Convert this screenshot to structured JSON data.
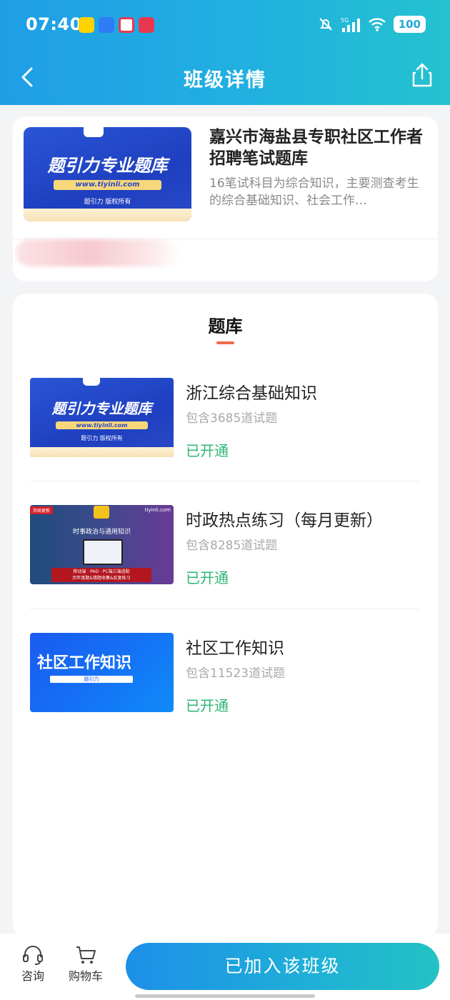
{
  "status_bar": {
    "time": "07:40",
    "battery": "100",
    "signal_label": "5G"
  },
  "nav": {
    "title": "班级详情"
  },
  "class_info": {
    "cover": {
      "title": "题引力专业题库",
      "url": "www.tiyinli.com",
      "copyright": "题引力 版权所有",
      "badge": "题引力"
    },
    "name": "嘉兴市海盐县专职社区工作者招聘笔试题库",
    "description": "16笔试科目为综合知识，主要测查考生的综合基础知识、社会工作…"
  },
  "bank": {
    "heading": "题库",
    "items": [
      {
        "title": "浙江综合基础知识",
        "count": "包含3685道试题",
        "status": "已开通",
        "cover_title": "题引力专业题库",
        "cover_url": "www.tiyinli.com",
        "cover_copyright": "题引力 版权所有",
        "cover_badge": "题引力"
      },
      {
        "title": "时政热点练习（每月更新）",
        "count": "包含8285道试题",
        "status": "已开通",
        "cover_tag": "持续更新",
        "cover_site": "tiyinli.com",
        "cover_heading": "时事政治与通用知识",
        "cover_line1": "移动端 · PAD · PC端三端适配",
        "cover_line2": "历年真题&错题收集&反复练习"
      },
      {
        "title": "社区工作知识",
        "count": "包含11523道试题",
        "status": "已开通",
        "cover_title": "社区工作知识",
        "cover_sub": "题引力"
      }
    ]
  },
  "bottom_bar": {
    "consult_label": "咨询",
    "cart_label": "购物车",
    "join_button": "已加入该班级"
  },
  "colors": {
    "accent_green": "#2bb673",
    "header_gradient_start": "#1f9ee6",
    "header_gradient_end": "#25c2cf",
    "tab_underline": "#ee6b4a"
  }
}
